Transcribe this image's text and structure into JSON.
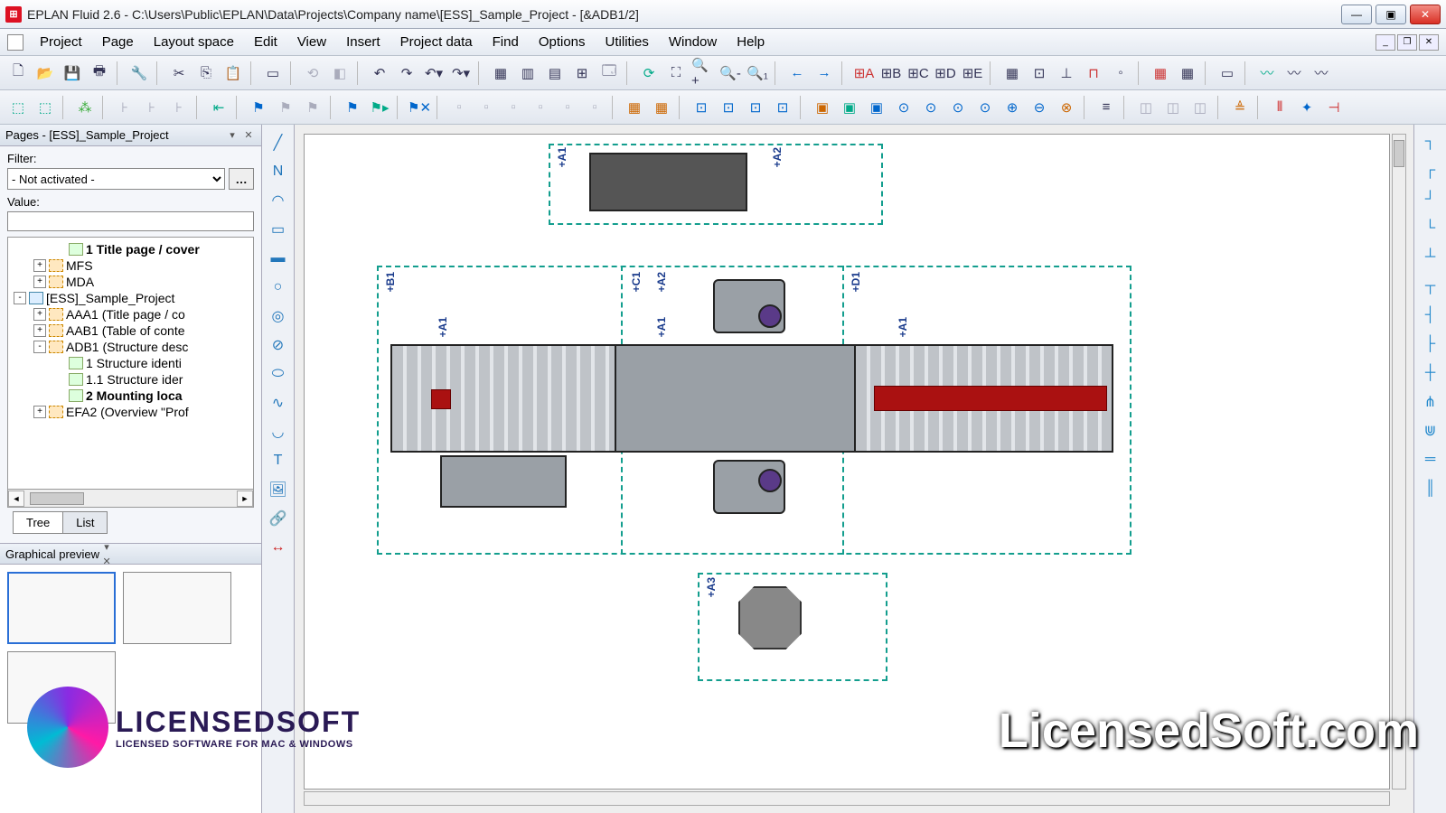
{
  "titlebar": {
    "app_name": "EPLAN Fluid 2.6",
    "path": "C:\\Users\\Public\\EPLAN\\Data\\Projects\\Company name\\[ESS]_Sample_Project",
    "doc": "[&ADB1/2]",
    "full": "EPLAN Fluid 2.6 - C:\\Users\\Public\\EPLAN\\Data\\Projects\\Company name\\[ESS]_Sample_Project - [&ADB1/2]"
  },
  "menu": [
    "Project",
    "Page",
    "Layout space",
    "Edit",
    "View",
    "Insert",
    "Project data",
    "Find",
    "Options",
    "Utilities",
    "Window",
    "Help"
  ],
  "pages_panel": {
    "title": "Pages - [ESS]_Sample_Project",
    "filter_label": "Filter:",
    "filter_value": "- Not activated -",
    "value_label": "Value:",
    "tabs": [
      "Tree",
      "List"
    ],
    "tree": [
      {
        "indent": 2,
        "expand": "",
        "icon": "page",
        "label": "1 Title page / cover",
        "bold": true
      },
      {
        "indent": 1,
        "expand": "+",
        "icon": "ic",
        "label": "MFS"
      },
      {
        "indent": 1,
        "expand": "+",
        "icon": "ic",
        "label": "MDA"
      },
      {
        "indent": 0,
        "expand": "-",
        "icon": "proj",
        "label": "[ESS]_Sample_Project"
      },
      {
        "indent": 1,
        "expand": "+",
        "icon": "ic",
        "label": "AAA1 (Title page / co"
      },
      {
        "indent": 1,
        "expand": "+",
        "icon": "ic",
        "label": "AAB1 (Table of conte"
      },
      {
        "indent": 1,
        "expand": "-",
        "icon": "ic",
        "label": "ADB1 (Structure desc"
      },
      {
        "indent": 2,
        "expand": "",
        "icon": "page",
        "label": "1 Structure identi"
      },
      {
        "indent": 2,
        "expand": "",
        "icon": "page",
        "label": "1.1 Structure ider"
      },
      {
        "indent": 2,
        "expand": "",
        "icon": "page",
        "label": "2 Mounting loca",
        "bold": true
      },
      {
        "indent": 1,
        "expand": "+",
        "icon": "ic",
        "label": "EFA2 (Overview \"Prof"
      }
    ]
  },
  "preview_panel": {
    "title": "Graphical preview"
  },
  "canvas_tags": [
    "+A1",
    "+A2",
    "+B1",
    "+C1",
    "+A2",
    "+A1",
    "+D1",
    "+A1",
    "+A1",
    "+A3"
  ],
  "watermark": {
    "site": "LicensedSoft.com",
    "brand": "LICENSEDSOFT",
    "tagline": "LICENSED SOFTWARE FOR MAC & WINDOWS"
  },
  "left_tools": [
    "line",
    "polyline",
    "arc",
    "rect",
    "rect-fill",
    "circle",
    "donut",
    "diag",
    "ellipse",
    "spline",
    "arc2",
    "text",
    "image",
    "link",
    "dimension"
  ],
  "right_tools": [
    "conn-nw",
    "conn-ne",
    "conn-sw",
    "conn-se",
    "t-up",
    "t-down",
    "t-left",
    "t-right",
    "cross",
    "y-split",
    "y-split2",
    "bus",
    "bus2"
  ]
}
